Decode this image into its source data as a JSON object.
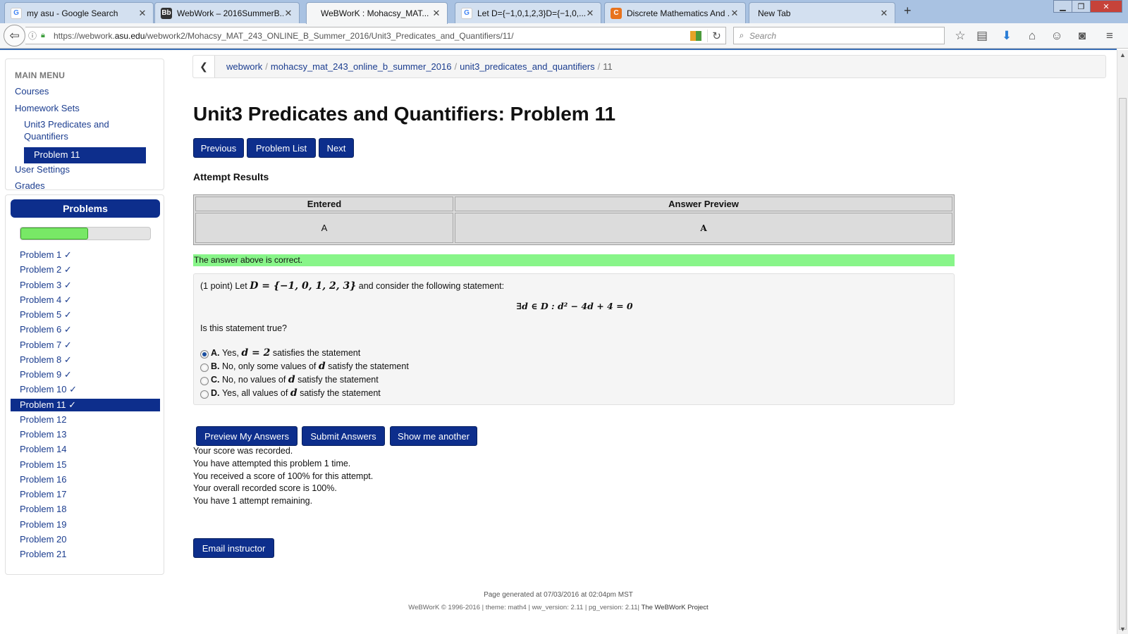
{
  "browser": {
    "tabs": [
      {
        "label": "my asu - Google Search",
        "icon": "google-icon",
        "color": "#ffffff",
        "active": false
      },
      {
        "label": "WebWork – 2016SummerB...",
        "icon": "blackboard-icon",
        "color": "#333333",
        "active": false
      },
      {
        "label": "WeBWorK : Mohacsy_MAT...",
        "icon": "",
        "color": "",
        "active": true
      },
      {
        "label": "Let D={−1,0,1,2,3}D={−1,0,...",
        "icon": "google-icon",
        "color": "#ffffff",
        "active": false
      },
      {
        "label": "Discrete Mathematics And ...",
        "icon": "chegg-icon",
        "color": "#e8731d",
        "active": false
      },
      {
        "label": "New Tab",
        "icon": "",
        "color": "",
        "active": false
      }
    ],
    "url_prefix": "https://webwork.",
    "url_domain": "asu.edu",
    "url_rest": "/webwork2/Mohacsy_MAT_243_ONLINE_B_Summer_2016/Unit3_Predicates_and_Quantifiers/11/",
    "search_placeholder": "Search"
  },
  "main_menu": {
    "header": "MAIN MENU",
    "courses": "Courses",
    "homework_sets": "Homework Sets",
    "set_name_line1": "Unit3 Predicates and",
    "set_name_line2": "Quantifiers",
    "current_problem": "Problem 11",
    "user_settings": "User Settings",
    "grades": "Grades"
  },
  "problems_panel": {
    "header": "Problems",
    "progress_fraction": 0.52,
    "items": [
      {
        "label": "Problem 1 ✓"
      },
      {
        "label": "Problem 2 ✓"
      },
      {
        "label": "Problem 3 ✓"
      },
      {
        "label": "Problem 4 ✓"
      },
      {
        "label": "Problem 5 ✓"
      },
      {
        "label": "Problem 6 ✓"
      },
      {
        "label": "Problem 7 ✓"
      },
      {
        "label": "Problem 8 ✓"
      },
      {
        "label": "Problem 9 ✓"
      },
      {
        "label": "Problem 10 ✓"
      },
      {
        "label": "Problem 11 ✓"
      },
      {
        "label": "Problem 12"
      },
      {
        "label": "Problem 13"
      },
      {
        "label": "Problem 14"
      },
      {
        "label": "Problem 15"
      },
      {
        "label": "Problem 16"
      },
      {
        "label": "Problem 17"
      },
      {
        "label": "Problem 18"
      },
      {
        "label": "Problem 19"
      },
      {
        "label": "Problem 20"
      },
      {
        "label": "Problem 21"
      }
    ]
  },
  "breadcrumb": {
    "items": [
      "webwork",
      "mohacsy_mat_243_online_b_summer_2016",
      "unit3_predicates_and_quantifiers"
    ],
    "current": "11"
  },
  "page_title": "Unit3 Predicates and Quantifiers: Problem 11",
  "nav_buttons": {
    "previous": "Previous",
    "problem_list": "Problem List",
    "next": "Next"
  },
  "attempt": {
    "heading": "Attempt Results",
    "col_entered": "Entered",
    "col_preview": "Answer Preview",
    "entered": "A",
    "preview": "A",
    "correct_message": "The answer above is correct."
  },
  "problem": {
    "points": "(1 point) Let",
    "set_math": "D = {−1, 0, 1, 2, 3}",
    "intro_tail": "and consider the following statement:",
    "statement_math": "∃d ∈ D : d² − 4d + 4 = 0",
    "question": "Is this statement true?",
    "options": [
      {
        "letter": "A.",
        "pre": "Yes,",
        "math": "d = 2",
        "post": "satisfies the statement",
        "checked": true
      },
      {
        "letter": "B.",
        "pre": "No, only some values of",
        "math": "d",
        "post": "satisfy the statement",
        "checked": false
      },
      {
        "letter": "C.",
        "pre": "No, no values of",
        "math": "d",
        "post": "satisfy the statement",
        "checked": false
      },
      {
        "letter": "D.",
        "pre": "Yes, all values of",
        "math": "d",
        "post": "satisfy the statement",
        "checked": false
      }
    ]
  },
  "action_buttons": {
    "preview": "Preview My Answers",
    "submit": "Submit Answers",
    "another": "Show me another"
  },
  "score_lines": [
    "Your score was recorded.",
    "You have attempted this problem 1 time.",
    "You received a score of 100% for this attempt.",
    "Your overall recorded score is 100%.",
    "You have 1 attempt remaining."
  ],
  "email_button": "Email instructor",
  "footer": {
    "generated": "Page generated at 07/03/2016 at 02:04pm MST",
    "version": "WeBWorK © 1996-2016 | theme: math4 | ww_version: 2.11 | pg_version: 2.11|",
    "project": "The WeBWorK Project"
  },
  "colors": {
    "brand_navy": "#0d2e8c",
    "correct_green": "#88f589",
    "progress_green": "#78e866"
  }
}
